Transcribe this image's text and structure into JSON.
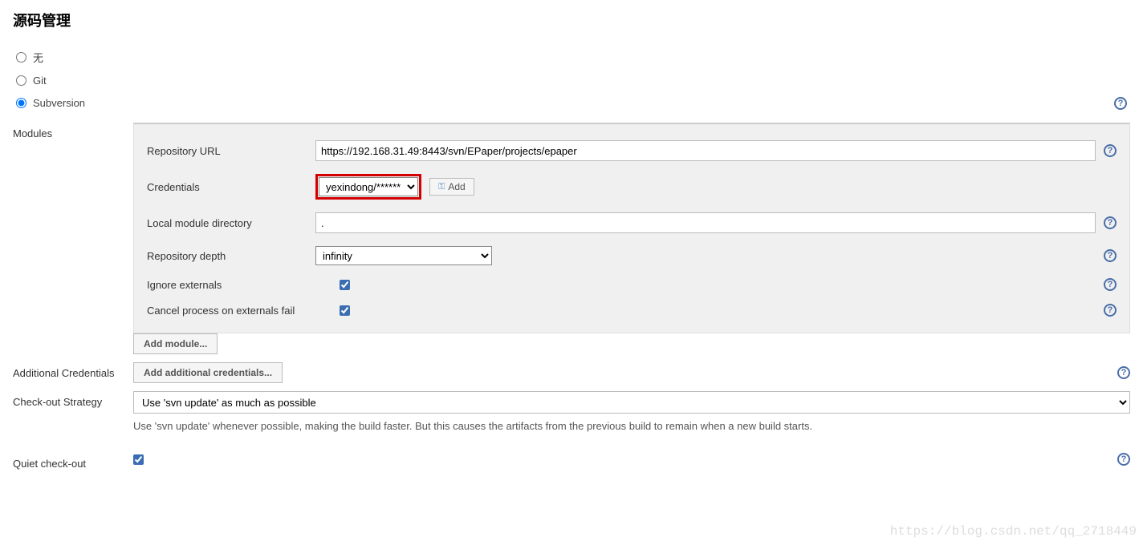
{
  "section_title": "源码管理",
  "scm": {
    "options": [
      {
        "label": "无",
        "checked": false
      },
      {
        "label": "Git",
        "checked": false
      },
      {
        "label": "Subversion",
        "checked": true
      }
    ]
  },
  "modules": {
    "label": "Modules",
    "repository_url": {
      "label": "Repository URL",
      "value": "https://192.168.31.49:8443/svn/EPaper/projects/epaper"
    },
    "credentials": {
      "label": "Credentials",
      "selected": "yexindong/******",
      "add_button": "Add"
    },
    "local_module_dir": {
      "label": "Local module directory",
      "value": "."
    },
    "repository_depth": {
      "label": "Repository depth",
      "selected": "infinity"
    },
    "ignore_externals": {
      "label": "Ignore externals",
      "checked": true
    },
    "cancel_on_externals_fail": {
      "label": "Cancel process on externals fail",
      "checked": true
    },
    "add_module_button": "Add module..."
  },
  "additional_credentials": {
    "label": "Additional Credentials",
    "button": "Add additional credentials..."
  },
  "checkout_strategy": {
    "label": "Check-out Strategy",
    "selected": "Use 'svn update' as much as possible",
    "description": "Use 'svn update' whenever possible, making the build faster. But this causes the artifacts from the previous build to remain when a new build starts."
  },
  "quiet_checkout": {
    "label": "Quiet check-out",
    "checked": true
  },
  "watermark": "https://blog.csdn.net/qq_2718449"
}
